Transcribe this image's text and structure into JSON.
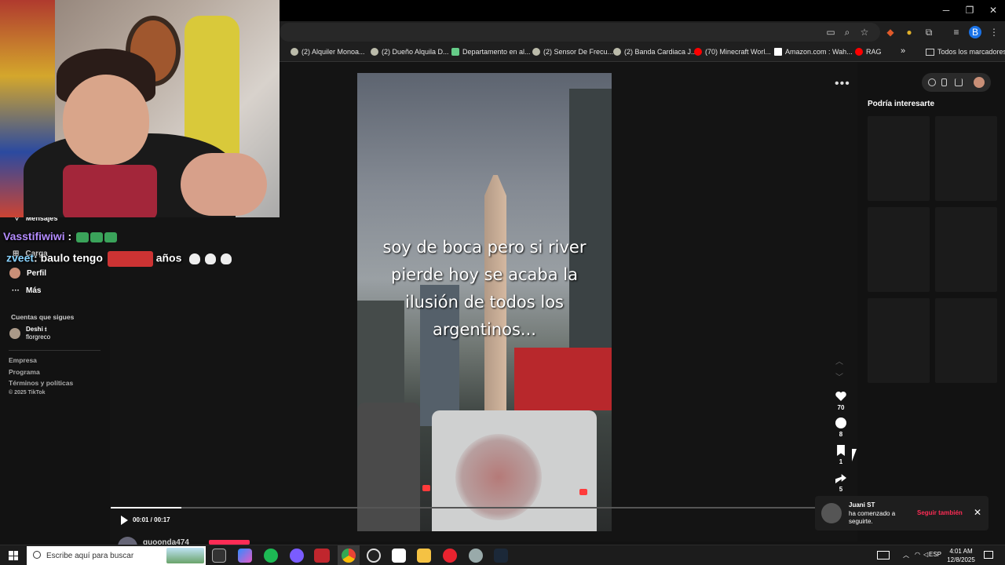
{
  "window_controls": {
    "minimize": "─",
    "restore": "❐",
    "close": "✕"
  },
  "bookmarks": [
    "(2) Alquiler Monoa...",
    "(2) Dueño Alquila D...",
    "Departamento en al...",
    "(2) Sensor De Frecu...",
    "(2) Banda Cardiaca J...",
    "(70) Minecraft Worl...",
    "Amazon.com : Wah...",
    "RAG"
  ],
  "bookmarks_overflow": "»",
  "bookmarks_all": "Todos los marcadores",
  "chat": {
    "line1_user": "Vasstifiwiwi",
    "line1_sep": ":",
    "line2_user": "zveet",
    "line2_text": ": baulo tengo",
    "line3_text": "años"
  },
  "sidebar": {
    "items": [
      "Mensajes",
      "Carga",
      "Perfil",
      "Más"
    ],
    "following_title": "Cuentas que sigues",
    "following_user": "Deshi 𝔱",
    "following_handle": "florgreco",
    "footer": [
      "Empresa",
      "Programa",
      "Términos y políticas",
      "© 2025 TikTok"
    ]
  },
  "video": {
    "caption": "soy de boca pero si river pierde hoy se acaba la ilusión de todos los argentinos...",
    "more": "•••",
    "time": "00:01 / 00:17",
    "progress": 0.1,
    "author": "quoonda474"
  },
  "actions": {
    "likes": "70",
    "comments": "8",
    "saves": "1",
    "shares": "5"
  },
  "right_panel": {
    "title": "Podría interesarte"
  },
  "notification": {
    "name": "Juani ST",
    "message": "ha comenzado a seguirte.",
    "button": "Seguir también",
    "close": "✕"
  },
  "taskbar": {
    "search_placeholder": "Escribe aquí para buscar",
    "lang": "ESP",
    "time": "4:01 AM",
    "date": "12/8/2025"
  },
  "colors": {
    "accent": "#fe2c55",
    "background": "#121212"
  }
}
